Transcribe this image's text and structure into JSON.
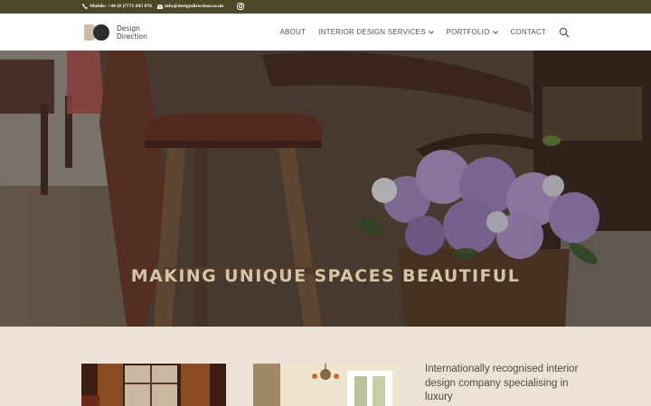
{
  "topbar": {
    "phone": "Mobile: +44 (0 )7771 645 876",
    "email": "info@designdirection.co.uk",
    "phone_icon": "phone-icon",
    "email_icon": "envelope-icon",
    "social_icon": "instagram-icon"
  },
  "header": {
    "logo_line1": "Design",
    "logo_line2": "Direction",
    "nav": [
      {
        "label": "ABOUT"
      },
      {
        "label": "INTERIOR DESIGN SERVICES"
      },
      {
        "label": "PORTFOLIO"
      },
      {
        "label": "CONTACT"
      }
    ],
    "search_icon": "search-icon"
  },
  "hero": {
    "title": "MAKING UNIQUE SPACES BEAUTIFUL"
  },
  "intro": {
    "text": "Internationally recognised interior design company specialising in luxury"
  },
  "colors": {
    "topbar_bg": "#4b4727",
    "hero_title": "#d3c6a6",
    "section_bg": "#ece3d6",
    "body_text": "#4d4b3a"
  }
}
